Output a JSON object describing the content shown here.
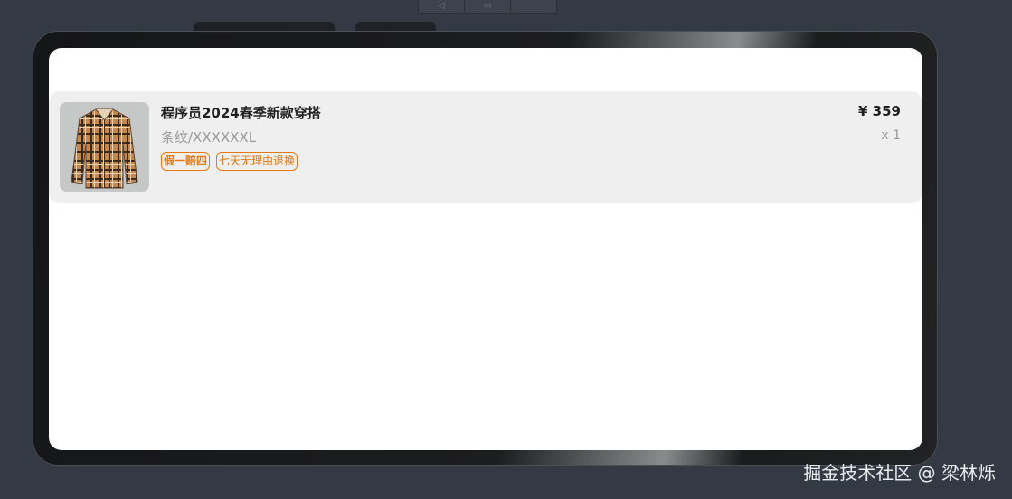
{
  "order_item": {
    "title": "程序员2024春季新款穿搭",
    "spec": "条纹/XXXXXXL",
    "tags": [
      "假一赔四",
      "七天无理由退换"
    ],
    "price": "¥ 359",
    "quantity": "x 1",
    "image_icon": "plaid-shirt-image"
  },
  "watermark": "掘金技术社区 @ 梁林烁",
  "colors": {
    "background": "#343a43",
    "card": "#efefef",
    "accent": "#e8780f",
    "muted_text": "#9a9a9a"
  }
}
